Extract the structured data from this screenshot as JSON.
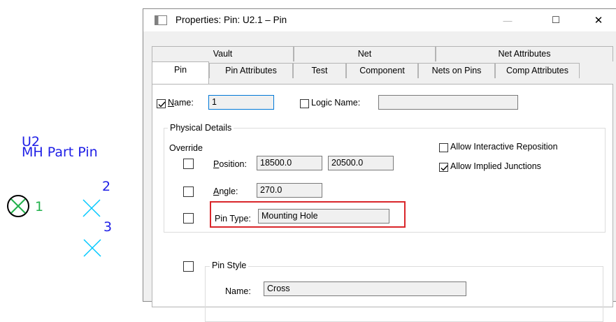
{
  "schematic": {
    "ref": "U2",
    "part_name": "MH Part Pin",
    "pins": [
      {
        "number": "1",
        "marker": "circle-x"
      },
      {
        "number": "2",
        "marker": "cross"
      },
      {
        "number": "3",
        "marker": "cross"
      }
    ],
    "colors": {
      "text": "#1e1ee6",
      "marker": "#00c8ff",
      "green": "#22b14c"
    }
  },
  "dialog": {
    "title": "Properties: Pin: U2.1 – Pin",
    "controls": {
      "minimize": "—",
      "maximize": "□",
      "close": "✕"
    },
    "tabs_back": [
      "Vault",
      "Net",
      "Net Attributes"
    ],
    "tabs_front": [
      "Pin",
      "Pin Attributes",
      "Test",
      "Component",
      "Nets on Pins",
      "Comp Attributes"
    ],
    "active_tab": "Pin",
    "name": {
      "checked": true,
      "label_underlined": "N",
      "label_rest": "ame:",
      "value": "1"
    },
    "logic_name": {
      "checked": false,
      "label_prefix": "Lo",
      "label_underlined": "g",
      "label_rest": "ic Name:",
      "value": ""
    },
    "physical_details": {
      "title": "Physical Details",
      "override_label": "Override",
      "position": {
        "override": false,
        "label_underlined": "P",
        "label_rest": "osition:",
        "x": "18500.0",
        "y": "20500.0"
      },
      "angle": {
        "override": false,
        "label_underlined": "A",
        "label_rest": "ngle:",
        "value": "270.0"
      },
      "pin_type": {
        "override": false,
        "label": "Pin Type:",
        "value": "Mounting Hole"
      },
      "allow_interactive_reposition": {
        "checked": false,
        "label": "Allow Interactive Reposition"
      },
      "allow_implied_junctions": {
        "checked": true,
        "label": "Allow Implied Junctions"
      }
    },
    "pin_style": {
      "override": false,
      "title": "Pin Style",
      "name_label": "Name:",
      "name_value": "Cross"
    },
    "highlight_color": "#d9262a"
  }
}
